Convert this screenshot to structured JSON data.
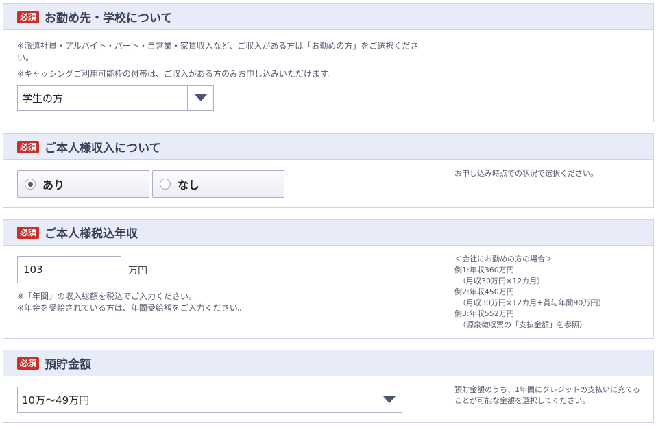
{
  "sections": {
    "workplace": {
      "required": "必須",
      "title": "お勤め先・学校について",
      "note1": "※派遣社員・アルバイト・パート・自営業・家賃収入など、ご収入がある方は「お勤めの方」をご選択ください。",
      "note2": "※キャッシングご利用可能枠の付帯は、ご収入がある方のみお申し込みいただけます。",
      "select_value": "学生の方",
      "arrow_icon": "chevron-down-icon"
    },
    "income": {
      "required": "必須",
      "title": "ご本人様収入について",
      "options": [
        {
          "label": "あり",
          "selected": true
        },
        {
          "label": "なし",
          "selected": false
        }
      ],
      "hint": "お申し込み時点での状況で選択ください。"
    },
    "annual_income": {
      "required": "必須",
      "title": "ご本人様税込年収",
      "input_value": "103",
      "unit": "万円",
      "note1": "※「年間」の収入総額を税込でご入力ください。",
      "note2": "※年金を受給されている方は、年間受給額をご入力ください。",
      "hint_lines": [
        "＜会社にお勤めの方の場合＞",
        "例1:年収360万円",
        "（月収30万円×12カ月）",
        "例2:年収450万円",
        "（月収30万円×12カ月+賞与年間90万円）",
        "例3:年収552万円",
        "（源泉徴収票の「支払金額」を参照）"
      ]
    },
    "savings": {
      "required": "必須",
      "title": "預貯金額",
      "select_value": "10万〜49万円",
      "hint": "預貯金額のうち、1年間にクレジットの支払いに充てることが可能な金額を選択してください。"
    }
  },
  "colors": {
    "header_bg": "#e8ecf8",
    "badge": "#c9302c",
    "border": "#cdd3e6"
  }
}
